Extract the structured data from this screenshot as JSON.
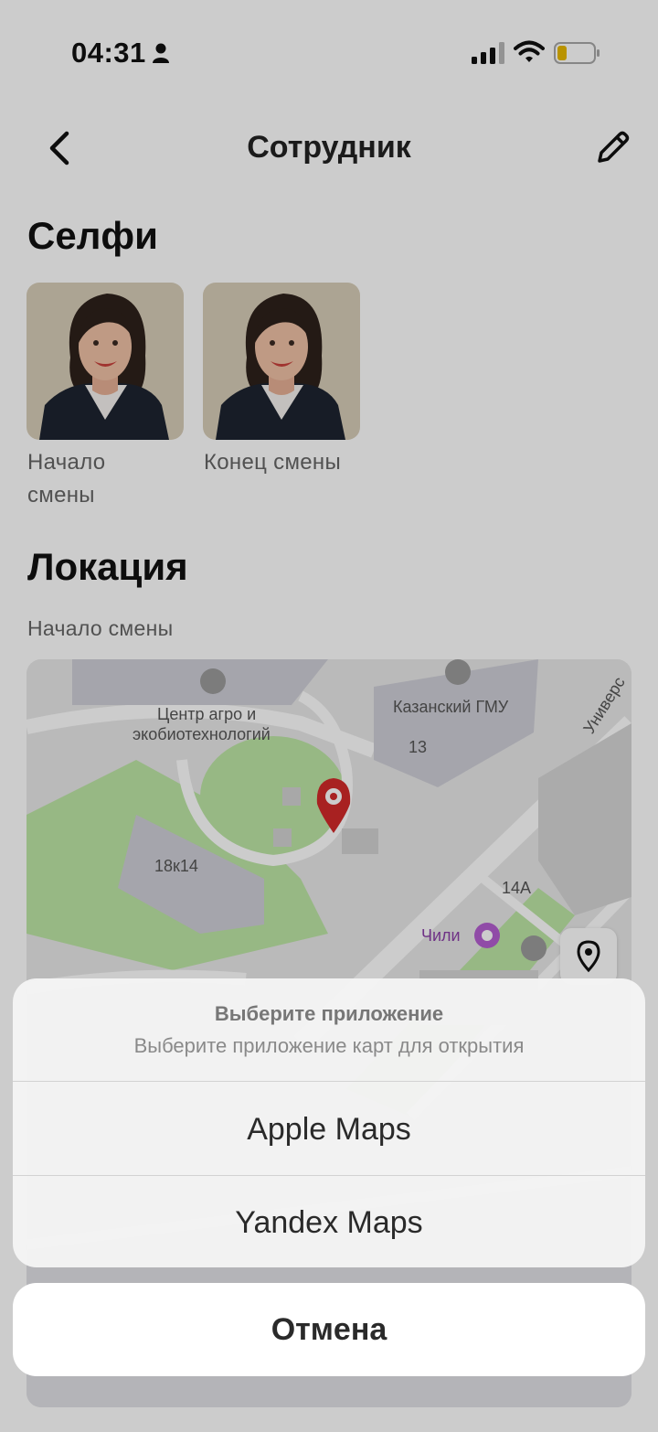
{
  "status_bar": {
    "time": "04:31"
  },
  "nav": {
    "title": "Сотрудник"
  },
  "selfie_section": {
    "heading": "Селфи",
    "items": [
      {
        "caption_line1": "Начало",
        "caption_line2": "смены"
      },
      {
        "caption_line1": "Конец смены"
      }
    ]
  },
  "location_section": {
    "heading": "Локация",
    "subheading": "Начало смены",
    "map": {
      "labels": {
        "center_line1": "Центр агро и",
        "center_line2": "экобиотехнологий",
        "kazan": "Казанский ГМУ",
        "num13": "13",
        "num18k14": "18к14",
        "num14a": "14А",
        "chili": "Чили",
        "street": "Универс"
      }
    }
  },
  "action_sheet": {
    "title": "Выберите приложение",
    "message": "Выберите приложение карт для открытия",
    "options": [
      "Apple Maps",
      "Yandex Maps"
    ],
    "cancel": "Отмена"
  },
  "colors": {
    "pin": "#d32a2a",
    "park": "#bde6a6",
    "building": "#cfcfd8"
  }
}
